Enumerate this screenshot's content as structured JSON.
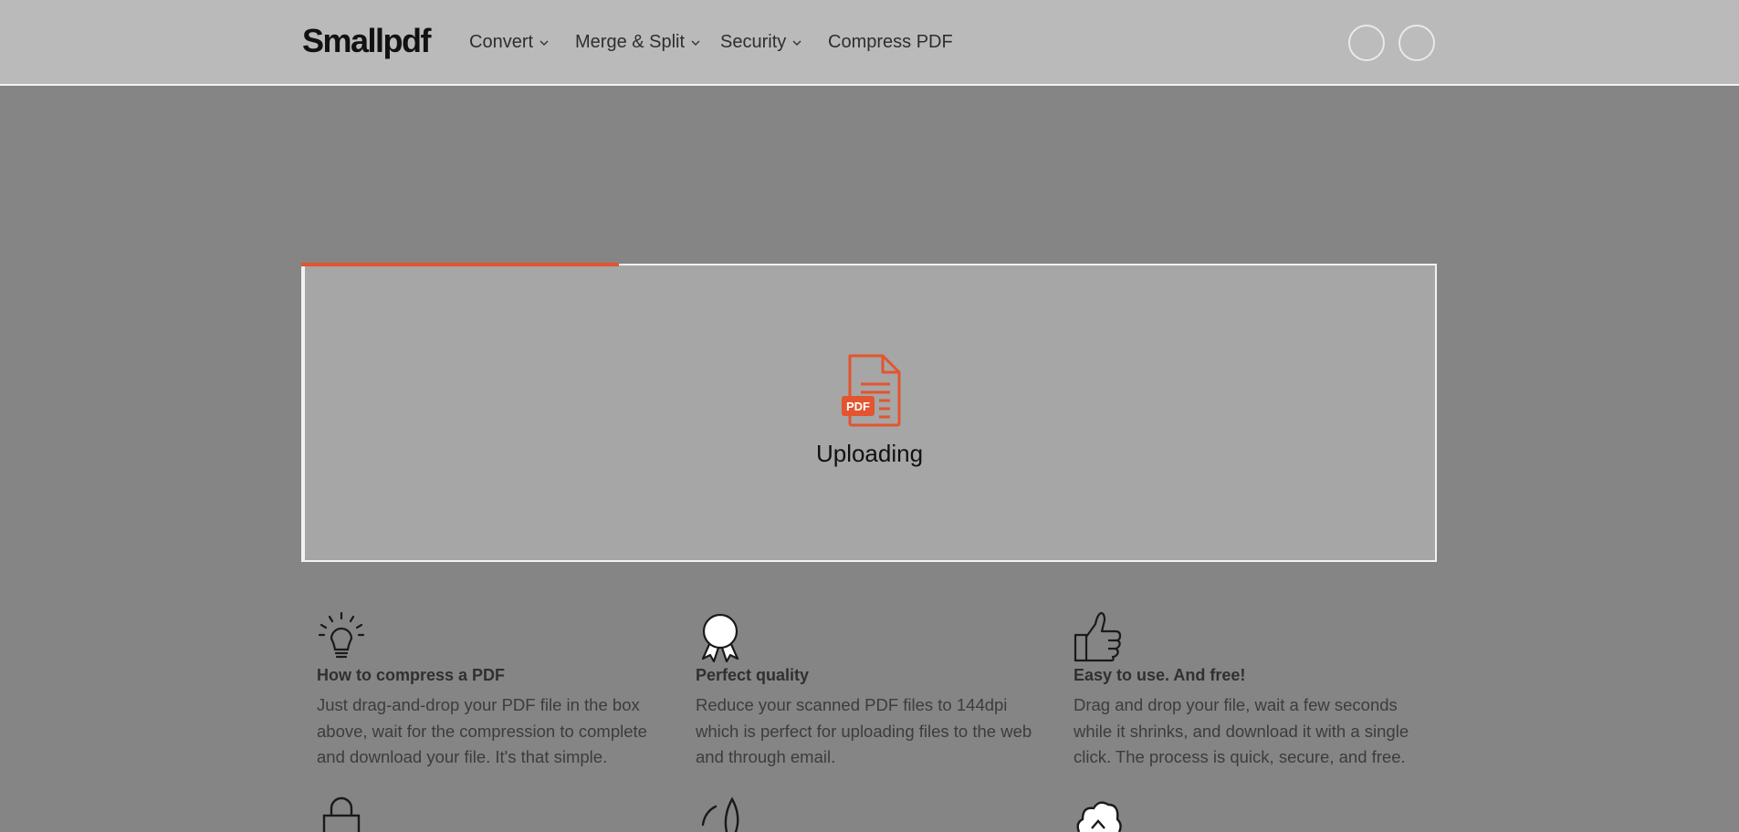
{
  "brand": {
    "logo": "Smallpdf"
  },
  "nav": {
    "items": [
      {
        "label": "Convert",
        "has_dropdown": true
      },
      {
        "label": "Merge & Split",
        "has_dropdown": true
      },
      {
        "label": "Security",
        "has_dropdown": true
      },
      {
        "label": "Compress PDF",
        "has_dropdown": false
      }
    ]
  },
  "upload": {
    "status": "Uploading",
    "file_badge": "PDF",
    "progress": 0.28,
    "accent": "#e4542f"
  },
  "features": [
    {
      "icon": "lightbulb-icon",
      "title": "How to compress a PDF",
      "lines": [
        "Just drag-and-drop your PDF file in the box",
        "above, wait for the compression to complete",
        "and download your file. It's that simple."
      ]
    },
    {
      "icon": "award-ribbon-icon",
      "title": "Perfect quality",
      "lines": [
        "Reduce your scanned PDF files to 144dpi",
        "which is perfect for uploading files to the web",
        "and through email."
      ]
    },
    {
      "icon": "thumbs-up-icon",
      "title": "Easy to use. And free!",
      "lines": [
        "Drag and drop your file, wait a few seconds",
        "while it shrinks, and download it with a single",
        "click. The process is quick, secure, and free."
      ]
    }
  ],
  "bottom_icons": [
    "lock-icon",
    "feather-icon",
    "cloud-icon"
  ]
}
